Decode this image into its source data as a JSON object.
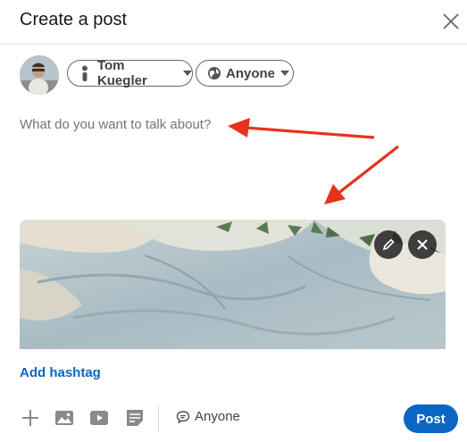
{
  "dialog": {
    "title": "Create a post",
    "close_icon": "close-icon"
  },
  "author": {
    "avatar": "user-avatar",
    "name": "Tom Kuegler",
    "name_icon": "person-icon",
    "visibility": "Anyone",
    "visibility_icon": "globe-icon"
  },
  "composer": {
    "placeholder": "What do you want to talk about?"
  },
  "media": {
    "edit_icon": "pencil-icon",
    "remove_icon": "close-icon"
  },
  "footer": {
    "add_hashtag": "Add hashtag",
    "tools": [
      "plus-icon",
      "photo-icon",
      "video-icon",
      "document-icon"
    ],
    "comment_visibility": "Anyone",
    "comment_icon": "comment-icon",
    "post_label": "Post"
  },
  "colors": {
    "accent": "#0a66c2",
    "arrow": "#e8321e"
  }
}
